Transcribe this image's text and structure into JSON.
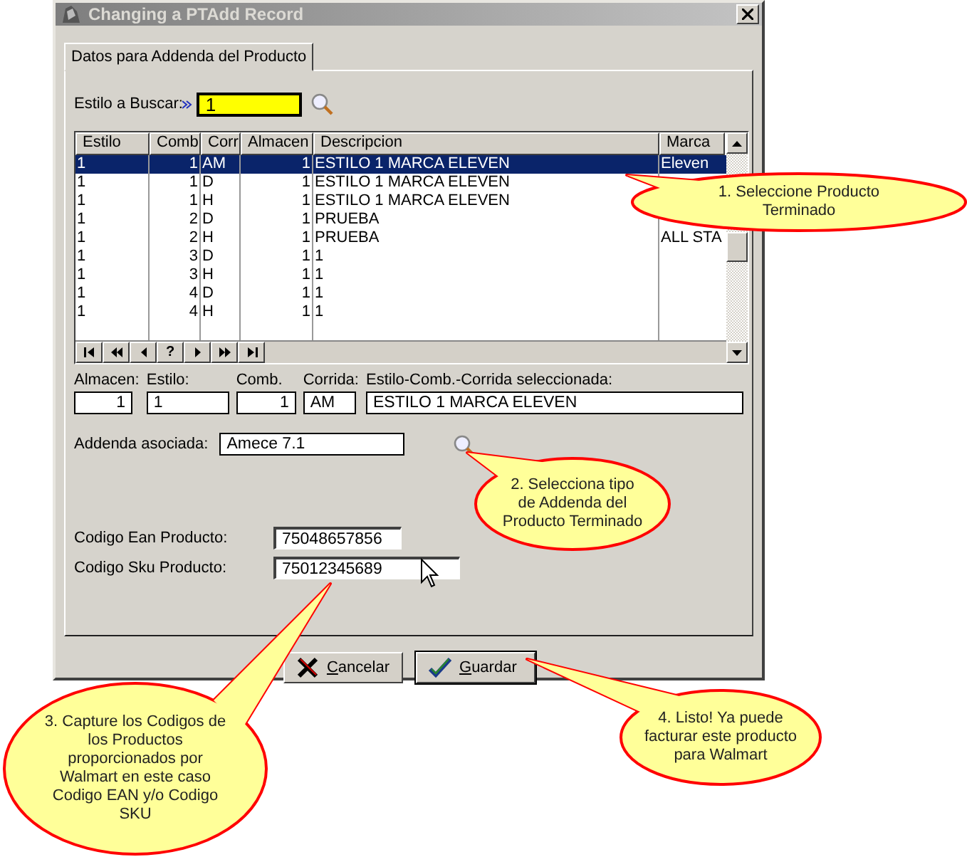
{
  "window": {
    "title": "Changing a PTAdd Record"
  },
  "tabs": [
    {
      "label": "Datos para Addenda del Producto",
      "selected": true
    }
  ],
  "search": {
    "label": "Estilo a Buscar:",
    "value": "1"
  },
  "grid": {
    "columns": [
      "Estilo",
      "Comb",
      "Corr",
      "Almacen",
      "Descripcion",
      "Marca"
    ],
    "rows": [
      {
        "cells": [
          "1",
          "1",
          "AM",
          "1",
          "ESTILO 1 MARCA ELEVEN",
          "Eleven"
        ],
        "selected": true
      },
      {
        "cells": [
          "1",
          "1",
          "D",
          "1",
          "ESTILO 1 MARCA ELEVEN"
        ],
        "selected": false
      },
      {
        "cells": [
          "1",
          "1",
          "H",
          "1",
          "ESTILO 1 MARCA ELEVEN"
        ],
        "selected": false
      },
      {
        "cells": [
          "1",
          "2",
          "D",
          "1",
          "PRUEBA"
        ],
        "selected": false
      },
      {
        "cells": [
          "1",
          "2",
          "H",
          "1",
          "PRUEBA",
          "ALL STA"
        ],
        "selected": false
      },
      {
        "cells": [
          "1",
          "3",
          "D",
          "1",
          "1"
        ],
        "selected": false
      },
      {
        "cells": [
          "1",
          "3",
          "H",
          "1",
          "1"
        ],
        "selected": false
      },
      {
        "cells": [
          "1",
          "4",
          "D",
          "1",
          "1"
        ],
        "selected": false
      },
      {
        "cells": [
          "1",
          "4",
          "H",
          "1",
          "1"
        ],
        "selected": false
      }
    ],
    "nav": [
      {
        "kind": "first"
      },
      {
        "kind": "prev-page"
      },
      {
        "kind": "prev"
      },
      {
        "kind": "help",
        "label": "?"
      },
      {
        "kind": "next"
      },
      {
        "kind": "next-page"
      },
      {
        "kind": "last"
      }
    ]
  },
  "selection": [
    {
      "label": "Almacen:",
      "value": "1",
      "kind": "number"
    },
    {
      "label": "Estilo:",
      "value": "1",
      "kind": "text"
    },
    {
      "label": "Comb.",
      "value": "1",
      "kind": "number"
    },
    {
      "label": "Corrida:",
      "value": "AM",
      "kind": "text"
    },
    {
      "label": "Estilo-Comb.-Corrida seleccionada:",
      "value": "ESTILO 1 MARCA ELEVEN",
      "kind": "wide"
    }
  ],
  "addenda": {
    "label": "Addenda asociada:",
    "value": "Amece 7.1"
  },
  "codes": [
    {
      "label": "Codigo Ean Producto:",
      "value": "75048657856"
    },
    {
      "label": "Codigo Sku Producto:",
      "value": "75012345689"
    }
  ],
  "buttons": [
    {
      "label": "Cancelar",
      "kind": "cancel"
    },
    {
      "label": "Guardar",
      "kind": "save"
    }
  ],
  "callouts": [
    {
      "text": "1. Seleccione Producto Terminado"
    },
    {
      "text": "2. Selecciona tipo de Addenda del Producto Terminado"
    },
    {
      "text": "3. Capture los Codigos de los Productos proporcionados por Walmart en este caso Codigo EAN y/o Codigo SKU"
    },
    {
      "text": "4. Listo! Ya puede facturar este producto para Walmart"
    }
  ]
}
